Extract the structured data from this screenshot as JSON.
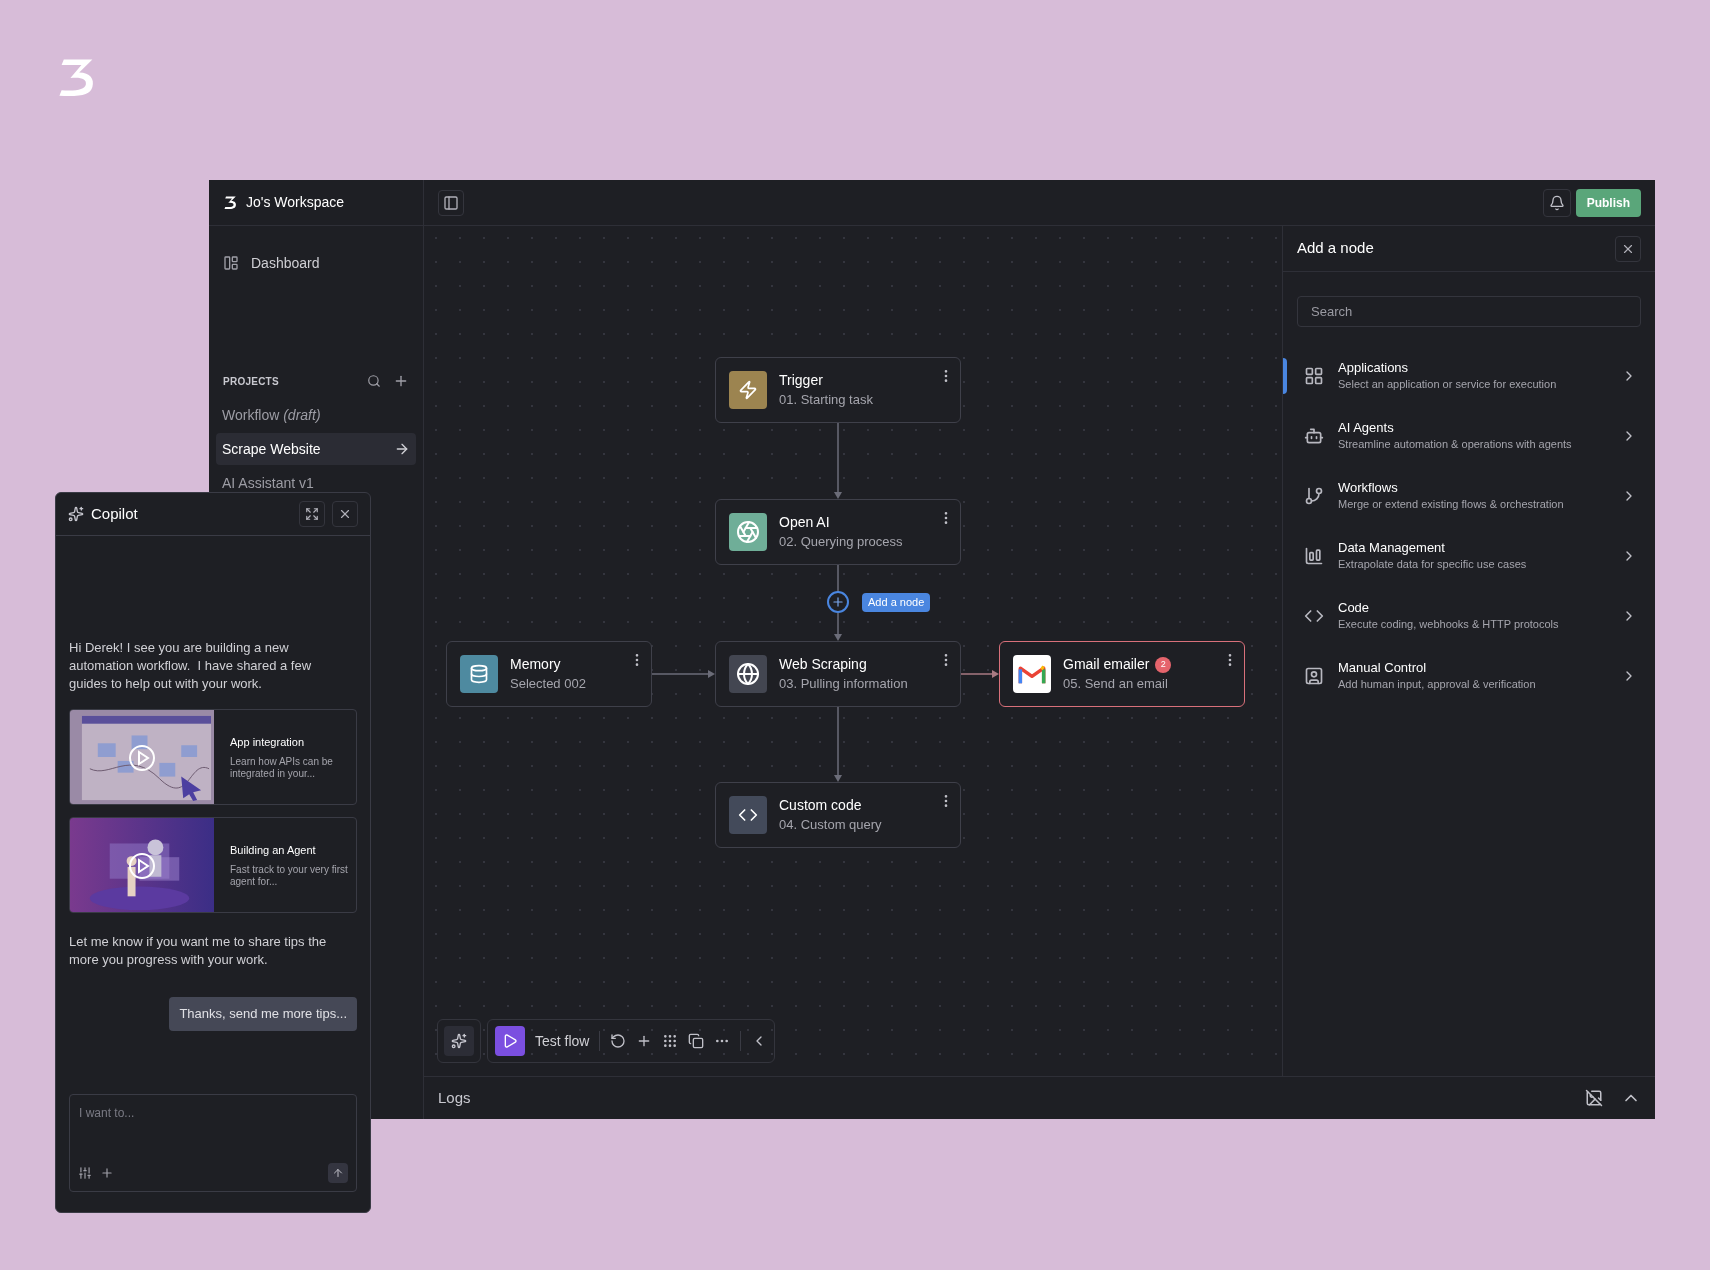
{
  "workspace": {
    "name": "Jo's Workspace"
  },
  "header": {
    "publish": "Publish"
  },
  "sidebar": {
    "items": [
      {
        "label": "Dashboard",
        "selected": false
      }
    ],
    "projects_heading": "PROJECTS",
    "projects": [
      {
        "label": "Workflow *(draft)*",
        "selected": false
      },
      {
        "label": "Scrape Website",
        "selected": true
      },
      {
        "label": "AI Assistant v1",
        "selected": false
      }
    ]
  },
  "canvas": {
    "nodes": [
      {
        "kind": "trigger",
        "title": "Trigger",
        "subtitle": "01. Starting task",
        "highlighted": false
      },
      {
        "kind": "openai",
        "title": "Open AI",
        "subtitle": "02. Querying process",
        "highlighted": false
      },
      {
        "kind": "memory",
        "title": "Memory",
        "subtitle": "Selected 002",
        "highlighted": false
      },
      {
        "kind": "web",
        "title": "Web Scraping",
        "subtitle": "03. Pulling information",
        "highlighted": false
      },
      {
        "kind": "gmail",
        "title": "Gmail emailer",
        "subtitle": "05. Send an email",
        "badge": "2",
        "highlighted": true
      },
      {
        "kind": "code",
        "title": "Custom code",
        "subtitle": "04. Custom query",
        "highlighted": false
      }
    ],
    "add_node_label": "Add a node"
  },
  "toolbar": {
    "test_flow": "Test flow"
  },
  "add_node_panel": {
    "title": "Add a node",
    "search": {
      "placeholder": "Search"
    },
    "categories": [
      {
        "kind": "apps",
        "title": "Applications",
        "description": "Select an application or service for execution",
        "selected": true
      },
      {
        "kind": "agents",
        "title": "AI Agents",
        "description": "Streamline automation & operations with agents",
        "selected": false
      },
      {
        "kind": "workflows",
        "title": "Workflows",
        "description": "Merge or extend existing flows & orchestration",
        "selected": false
      },
      {
        "kind": "data",
        "title": "Data Management",
        "description": "Extrapolate data for specific use cases",
        "selected": false
      },
      {
        "kind": "code",
        "title": "Code",
        "description": "Execute coding, webhooks & HTTP protocols",
        "selected": false
      },
      {
        "kind": "manual",
        "title": "Manual Control",
        "description": "Add human input, approval & verification",
        "selected": false
      }
    ]
  },
  "logs": {
    "title": "Logs"
  },
  "copilot": {
    "title": "Copilot",
    "intro": "Hi Derek! I see you are building a new automation workflow.  I have shared a few guides to help out with your work.",
    "guides": [
      {
        "kind": "picture",
        "title": "App integration",
        "description": "Learn how APIs can be integrated in your..."
      },
      {
        "kind": "picture",
        "title": "Building an Agent",
        "description": "Fast track to your very first agent for..."
      }
    ],
    "outro": "Let me know if you want me to share tips the more you progress with your work.",
    "reply": "Thanks, send me more tips...",
    "input": {
      "placeholder": "I want to..."
    }
  }
}
